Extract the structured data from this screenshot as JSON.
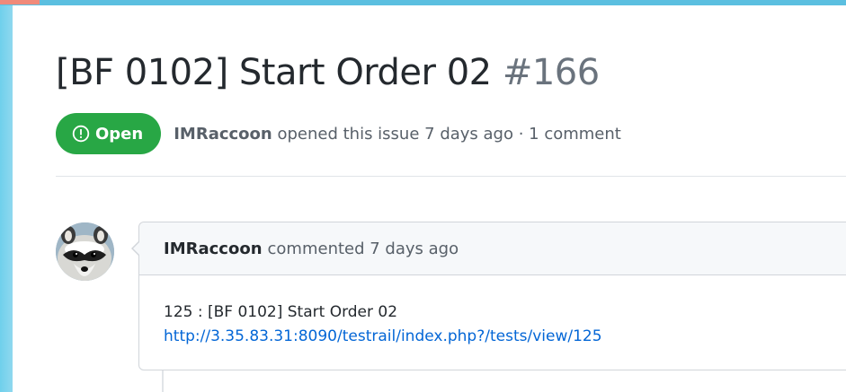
{
  "colors": {
    "open_badge": "#28a745",
    "link": "#0366d6",
    "title_text": "#24292e",
    "muted_text": "#586069",
    "issue_number": "#6a737d"
  },
  "issue": {
    "title": "[BF 0102] Start Order 02",
    "number": "#166",
    "state_label": "Open",
    "state_icon": "issue-opened-icon",
    "author": "IMRaccoon",
    "meta_suffix": "opened this issue 7 days ago · 1 comment"
  },
  "comment": {
    "avatar_icon": "raccoon-avatar",
    "author": "IMRaccoon",
    "header_suffix": "commented 7 days ago",
    "body_line": "125 : [BF 0102] Start Order 02",
    "link_text": "http://3.35.83.31:8090/testrail/index.php?/tests/view/125"
  }
}
